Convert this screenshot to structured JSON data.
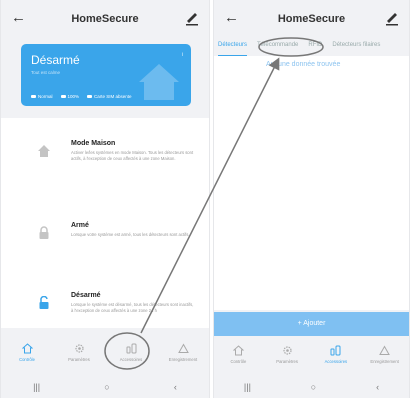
{
  "left": {
    "title": "HomeSecure",
    "status": {
      "title": "Désarmé",
      "subtitle": "Tout est calme",
      "info_badge": "i",
      "network": "Normal",
      "battery": "100%",
      "sim": "Carte SIM absente"
    },
    "modes": [
      {
        "title": "Mode Maison",
        "desc": "Activer le/les systèmes en mode Maison. Tous les détecteurs sont actifs, à l'exception de ceux affectés à une zone Maison."
      },
      {
        "title": "Armé",
        "desc": "Lorsque votre système est armé, tous les détecteurs sont actifs."
      },
      {
        "title": "Désarmé",
        "desc": "Lorsque le système est désarmé, tous les détecteurs sont inactifs, à l'exception de ceux affectés à une zone 24 h"
      }
    ],
    "nav": [
      "Contrôle",
      "Paramètres",
      "Accessoires",
      "Enregistrement"
    ]
  },
  "right": {
    "title": "HomeSecure",
    "tabs": [
      "Détecteurs",
      "Télécommande",
      "RFID",
      "Détecteurs filaires"
    ],
    "empty_text": "Aucune donnée trouvée",
    "add_button": "+ Ajouter",
    "nav": [
      "Contrôle",
      "Paramètres",
      "Accessoires",
      "Enregistrement"
    ]
  },
  "system": {
    "recents": "|||",
    "home": "○",
    "back": "‹"
  },
  "colors": {
    "accent": "#3aa5ea",
    "annotation": "#777777"
  }
}
